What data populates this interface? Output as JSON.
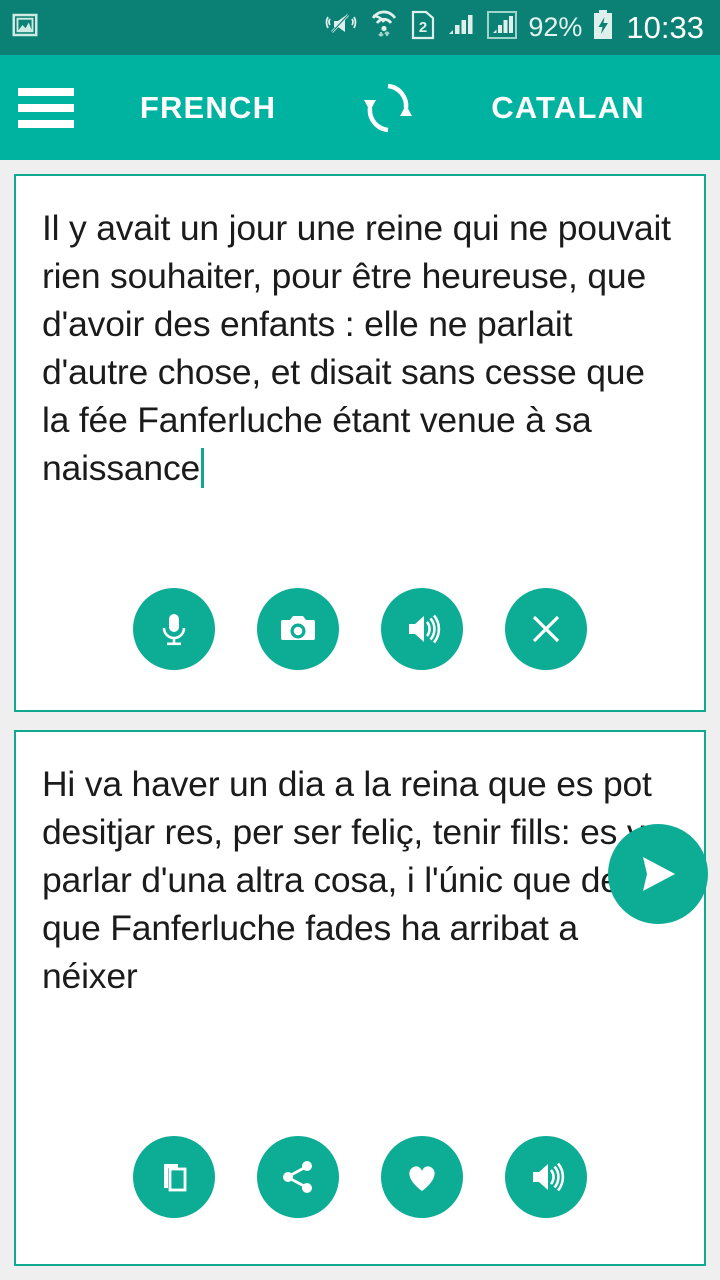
{
  "status_bar": {
    "notification_icon": "image-icon",
    "icons": [
      "vibrate-off-icon",
      "wifi-icon",
      "sim2-icon",
      "signal-1-icon",
      "signal-2-icon"
    ],
    "battery_percent": "92%",
    "battery_icon": "battery-charging-icon",
    "time": "10:33",
    "background_color": "#0a8174"
  },
  "app_bar": {
    "menu_icon": "hamburger-icon",
    "source_language": "FRENCH",
    "swap_icon": "swap-languages-icon",
    "target_language": "CATALAN",
    "background_color": "#00b3a1"
  },
  "source_card": {
    "text": "Il y avait un jour une reine qui ne pouvait rien souhaiter, pour être heureuse, que d'avoir des enfants : elle ne parlait d'autre chose, et disait sans cesse que la fée Fanferluche étant venue à sa naissance",
    "caret_visible": true,
    "actions": [
      {
        "name": "microphone-button",
        "icon": "microphone-icon",
        "label": "Voice input"
      },
      {
        "name": "camera-button",
        "icon": "camera-icon",
        "label": "Camera input"
      },
      {
        "name": "speak-source-button",
        "icon": "speaker-icon",
        "label": "Listen"
      },
      {
        "name": "clear-button",
        "icon": "close-icon",
        "label": "Clear"
      }
    ]
  },
  "send_button": {
    "icon": "send-icon",
    "label": "Translate"
  },
  "target_card": {
    "text": "Hi va haver un dia a la reina que es pot desitjar res, per ser feliç, tenir fills: es va parlar d'una altra cosa, i l'únic que deia que Fanferluche fades ha arribat a néixer",
    "actions": [
      {
        "name": "copy-button",
        "icon": "copy-icon",
        "label": "Copy"
      },
      {
        "name": "share-button",
        "icon": "share-icon",
        "label": "Share"
      },
      {
        "name": "favorite-button",
        "icon": "heart-icon",
        "label": "Favorite"
      },
      {
        "name": "speak-target-button",
        "icon": "speaker-icon",
        "label": "Listen"
      }
    ]
  },
  "colors": {
    "accent": "#0cac95",
    "app_bar": "#00b3a1",
    "status_bar": "#0a8174",
    "card_border": "#0fa891",
    "page_background": "#efefef",
    "text": "#1b1b1b"
  }
}
